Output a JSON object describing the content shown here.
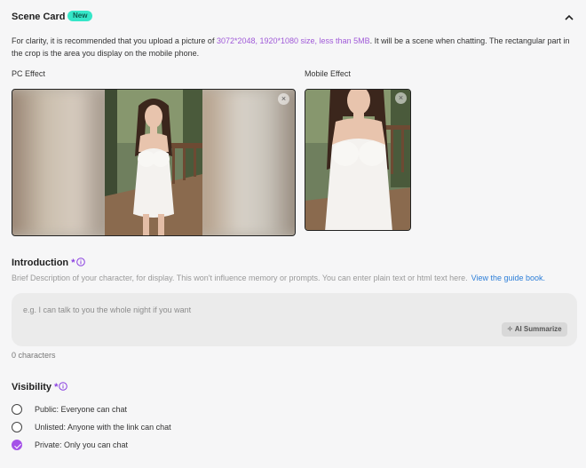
{
  "header": {
    "title": "Scene Card",
    "badge": "New"
  },
  "description": {
    "before": "For clarity, it is recommended that you upload a picture of ",
    "highlight": "3072*2048, 1920*1080 size, less than 5MB",
    "after": ". It will be a scene when chatting. The rectangular part in the crop is the area you display on the mobile phone."
  },
  "preview": {
    "pc_label": "PC Effect",
    "mobile_label": "Mobile Effect",
    "close_glyph": "×"
  },
  "introduction": {
    "title": "Introduction",
    "required_mark": "*",
    "help": "Brief Description of your character, for display. This won't influence memory or prompts. You can enter plain text or html text here.",
    "guide_link": "View the guide book.",
    "placeholder": "e.g. I can talk to you the whole night if you want",
    "value": "",
    "ai_button": "AI Summarize",
    "char_count": "0 characters"
  },
  "visibility": {
    "title": "Visibility",
    "required_mark": "*",
    "options": [
      {
        "label": "Public: Everyone can chat",
        "selected": false
      },
      {
        "label": "Unlisted: Anyone with the link can chat",
        "selected": false
      },
      {
        "label": "Private: Only you can chat",
        "selected": true
      }
    ]
  },
  "colors": {
    "accent": "#a552e8",
    "badge": "#35e6c8",
    "link": "#2e7fd8",
    "highlight": "#a05ad8"
  },
  "icons": {
    "collapse": "chevron-up-icon",
    "info": "info-icon",
    "sparkle": "sparkle-icon",
    "close": "close-icon"
  }
}
